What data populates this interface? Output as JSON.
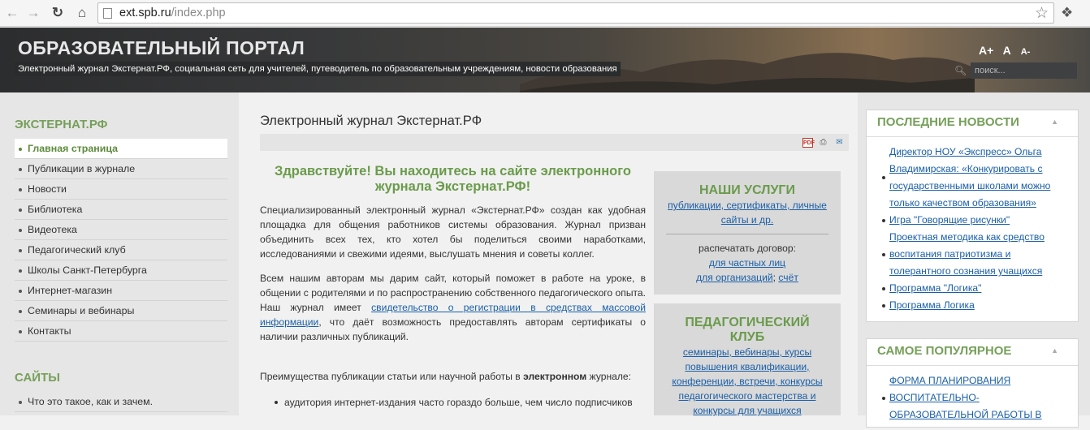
{
  "browser": {
    "url_host": "ext.spb.ru",
    "url_path": "/index.php"
  },
  "header": {
    "title": "ОБРАЗОВАТЕЛЬНЫЙ ПОРТАЛ",
    "tagline": "Электронный журнал Экстернат.РФ, социальная сеть для учителей, путеводитель по образовательным учреждениям, новости образования",
    "font_controls": [
      "A+",
      "A",
      "A-"
    ],
    "search_placeholder": "поиск..."
  },
  "left_sidebar": {
    "section1_title": "ЭКСТЕРНАТ.РФ",
    "menu": [
      "Главная страница",
      "Публикации в журнале",
      "Новости",
      "Библиотека",
      "Видеотека",
      "Педагогический клуб",
      "Школы Санкт-Петербурга",
      "Интернет-магазин",
      "Семинары и вебинары",
      "Контакты"
    ],
    "active_index": 0,
    "section2_title": "САЙТЫ",
    "menu2": [
      "Что это такое, как и зачем."
    ]
  },
  "main": {
    "page_title": "Электронный журнал Экстернат.РФ",
    "welcome": "Здравствуйте! Вы находитесь на сайте электронного журнала Экстернат.РФ!",
    "para1": "Специализированный электронный журнал «Экстернат.РФ» создан как удобная площадка для общения работников системы образования. Журнал призван объединить всех тех, кто хотел бы поделиться своими наработками, исследованиями и свежими идеями, выслушать мнения и советы коллег.",
    "para2_start": "Всем нашим авторам мы дарим сайт, который поможет в работе на уроке, в общении с родителями и по распространению собственного педагогического опыта. Наш журнал имеет ",
    "para2_link": "свидетельство о регистрации в средствах массовой информации",
    "para2_end": ", что даёт возможность предоставлять авторам сертификаты о наличии различных публикаций.",
    "para3_start": "Преимущества публикации статьи или научной работы в ",
    "para3_bold": "электронном",
    "para3_end": " журнале:",
    "benefits": [
      "аудитория интернет-издания часто гораздо больше, чем число подписчиков"
    ]
  },
  "services": {
    "title": "НАШИ УСЛУГИ",
    "link": "публикации, сертификаты, личные сайты и др.",
    "contract_label": "распечатать договор:",
    "contract_private": "для частных лиц",
    "contract_org": "для организаций",
    "separator": ";",
    "invoice": "счёт"
  },
  "club": {
    "title": "ПЕДАГОГИЧЕСКИЙ КЛУБ",
    "links": "семинары, вебинары, курсы повышения квалификации, конференции, встречи, конкурсы педагогического мастерства и конкурсы для учащихся"
  },
  "right_sidebar": {
    "news_title": "ПОСЛЕДНИЕ НОВОСТИ",
    "news": [
      "Директор НОУ «Экспресс» Ольга Владимирская: «Конкурировать с государственными школами можно только качеством образования»",
      "Игра \"Говорящие рисунки\"",
      "Проектная методика как средство воспитания патриотизма и толерантного сознания учащихся",
      "Программа \"Логика\"",
      "Программа Логика"
    ],
    "popular_title": "САМОЕ ПОПУЛЯРНОЕ",
    "popular": [
      "ФОРМА ПЛАНИРОВАНИЯ ВОСПИТАТЕЛЬНО-ОБРАЗОВАТЕЛЬНОЙ РАБОТЫ В"
    ]
  }
}
